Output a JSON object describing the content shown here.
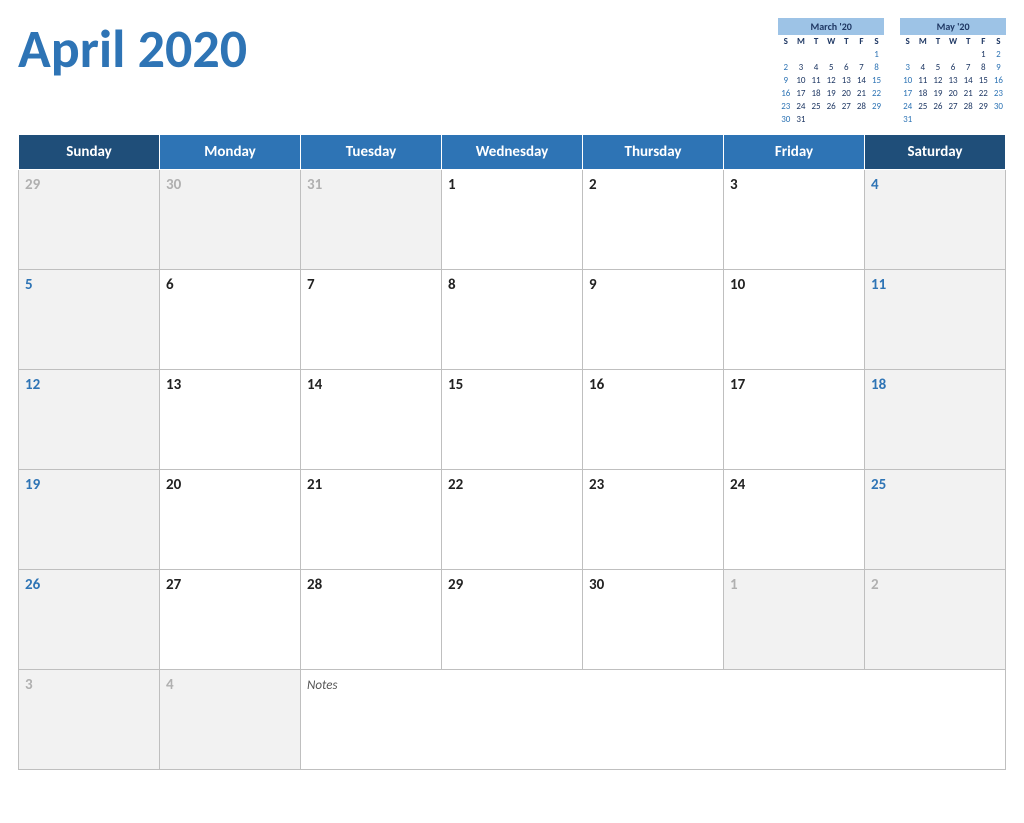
{
  "title": "April 2020",
  "header": {
    "month_year": "April 2020"
  },
  "mini_cal_march": {
    "title": "March '20",
    "days_header": [
      "S",
      "M",
      "T",
      "W",
      "T",
      "F",
      "S"
    ],
    "weeks": [
      [
        "",
        "",
        "",
        "",
        "",
        "",
        "1"
      ],
      [
        "2",
        "3",
        "4",
        "5",
        "6",
        "7",
        "8"
      ],
      [
        "9",
        "10",
        "11",
        "12",
        "13",
        "14",
        "15"
      ],
      [
        "16",
        "17",
        "18",
        "19",
        "20",
        "21",
        "22"
      ],
      [
        "23",
        "24",
        "25",
        "26",
        "27",
        "28",
        "29"
      ],
      [
        "30",
        "31",
        "",
        "",
        "",
        "",
        ""
      ]
    ]
  },
  "mini_cal_may": {
    "title": "May '20",
    "days_header": [
      "S",
      "M",
      "T",
      "W",
      "T",
      "F",
      "S"
    ],
    "weeks": [
      [
        "",
        "",
        "",
        "",
        "",
        "1",
        "2"
      ],
      [
        "3",
        "4",
        "5",
        "6",
        "7",
        "8",
        "9"
      ],
      [
        "10",
        "11",
        "12",
        "13",
        "14",
        "15",
        "16"
      ],
      [
        "17",
        "18",
        "19",
        "20",
        "21",
        "22",
        "23"
      ],
      [
        "24",
        "25",
        "26",
        "27",
        "28",
        "29",
        "30"
      ],
      [
        "31",
        "",
        "",
        "",
        "",
        "",
        ""
      ]
    ]
  },
  "day_headers": [
    "Sunday",
    "Monday",
    "Tuesday",
    "Wednesday",
    "Thursday",
    "Friday",
    "Saturday"
  ],
  "weeks": [
    [
      {
        "num": "29",
        "type": "outside"
      },
      {
        "num": "30",
        "type": "outside"
      },
      {
        "num": "31",
        "type": "outside"
      },
      {
        "num": "1",
        "type": "current"
      },
      {
        "num": "2",
        "type": "current"
      },
      {
        "num": "3",
        "type": "current"
      },
      {
        "num": "4",
        "type": "current-weekend"
      }
    ],
    [
      {
        "num": "5",
        "type": "current-weekend-sun"
      },
      {
        "num": "6",
        "type": "current"
      },
      {
        "num": "7",
        "type": "current"
      },
      {
        "num": "8",
        "type": "current"
      },
      {
        "num": "9",
        "type": "current"
      },
      {
        "num": "10",
        "type": "current"
      },
      {
        "num": "11",
        "type": "current-weekend"
      }
    ],
    [
      {
        "num": "12",
        "type": "current-weekend-sun"
      },
      {
        "num": "13",
        "type": "current"
      },
      {
        "num": "14",
        "type": "current"
      },
      {
        "num": "15",
        "type": "current"
      },
      {
        "num": "16",
        "type": "current"
      },
      {
        "num": "17",
        "type": "current"
      },
      {
        "num": "18",
        "type": "current-weekend"
      }
    ],
    [
      {
        "num": "19",
        "type": "current-weekend-sun"
      },
      {
        "num": "20",
        "type": "current"
      },
      {
        "num": "21",
        "type": "current"
      },
      {
        "num": "22",
        "type": "current"
      },
      {
        "num": "23",
        "type": "current"
      },
      {
        "num": "24",
        "type": "current"
      },
      {
        "num": "25",
        "type": "current-weekend"
      }
    ],
    [
      {
        "num": "26",
        "type": "current-weekend-sun"
      },
      {
        "num": "27",
        "type": "current"
      },
      {
        "num": "28",
        "type": "current"
      },
      {
        "num": "29",
        "type": "current"
      },
      {
        "num": "30",
        "type": "current"
      },
      {
        "num": "1",
        "type": "outside"
      },
      {
        "num": "2",
        "type": "outside-weekend"
      }
    ]
  ],
  "last_row": {
    "cells": [
      {
        "num": "3",
        "type": "outside"
      },
      {
        "num": "4",
        "type": "outside"
      },
      {
        "notes": "Notes",
        "colspan": 5,
        "type": "notes"
      }
    ]
  },
  "notes_label": "Notes"
}
